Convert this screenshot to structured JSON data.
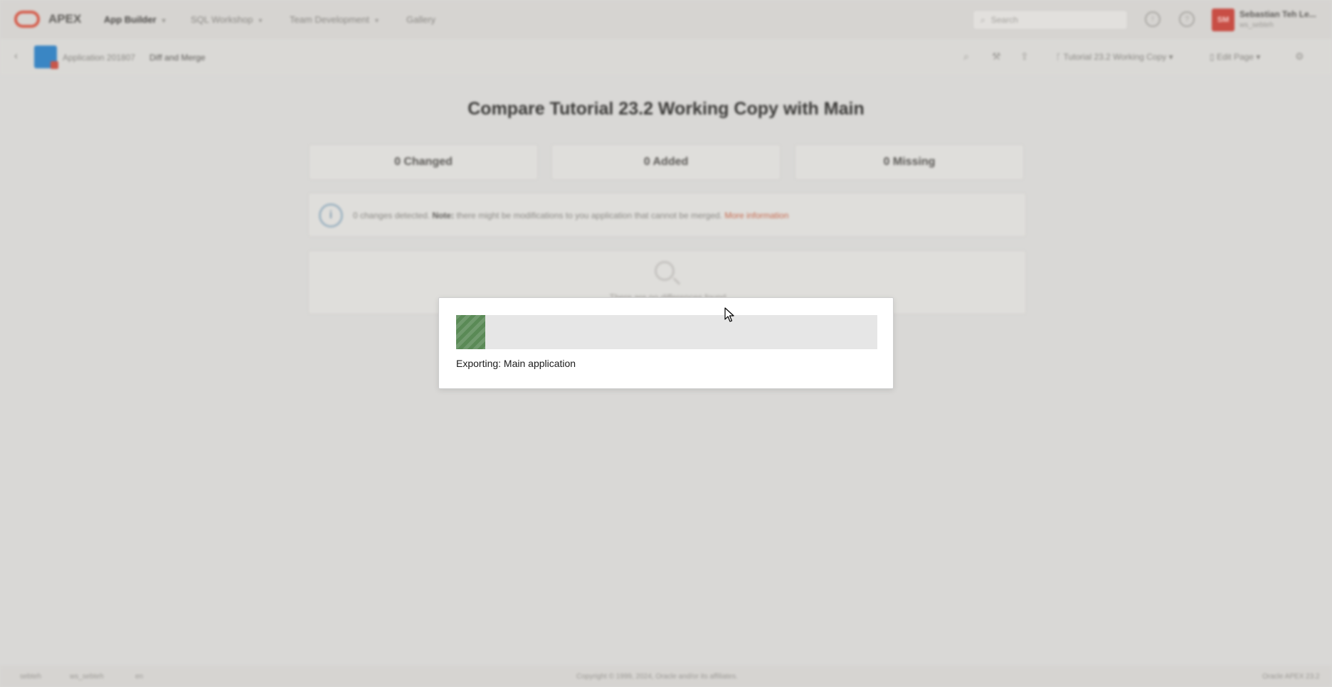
{
  "topbar": {
    "brand": "APEX",
    "nav": [
      {
        "label": "App Builder",
        "active": true
      },
      {
        "label": "SQL Workshop",
        "active": false
      },
      {
        "label": "Team Development",
        "active": false
      },
      {
        "label": "Gallery",
        "active": false
      }
    ],
    "search_placeholder": "Search",
    "user": {
      "initials": "SM",
      "name": "Sebastian Teh Le...",
      "workspace": "ws_sebteh"
    }
  },
  "subbar": {
    "breadcrumb": [
      "Application 201807",
      "Diff and Merge"
    ],
    "working_copy": "Tutorial 23.2 Working Copy",
    "edit_page": "Edit Page"
  },
  "main": {
    "title": "Compare Tutorial 23.2 Working Copy with Main",
    "stats": [
      "0 Changed",
      "0 Added",
      "0 Missing"
    ],
    "info": {
      "prefix": "0 changes detected.",
      "note_label": "Note:",
      "note_text": "there might be modifications to you application that cannot be merged.",
      "link": "More information"
    },
    "empty": "There are no differences found"
  },
  "footer": {
    "left": [
      "sebteh",
      "ws_sebteh",
      "en"
    ],
    "center": "Copyright © 1999, 2024, Oracle and/or its affiliates.",
    "right": "Oracle APEX 23.2"
  },
  "dialog": {
    "progress": 0.07,
    "progress_color": "#5a8a56",
    "status_text": "Exporting: Main application"
  }
}
